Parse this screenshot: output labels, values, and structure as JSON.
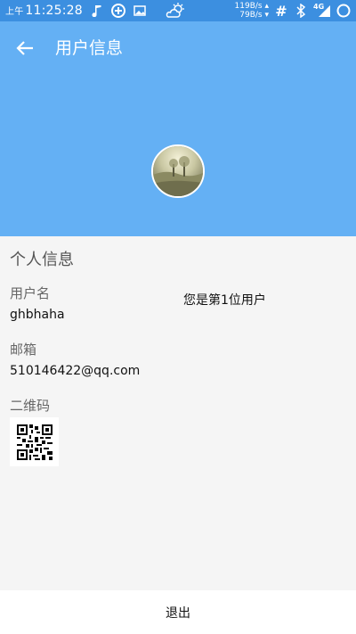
{
  "status_bar": {
    "ampm": "上午",
    "time": "11:25:28",
    "speed_up": "119B/s",
    "speed_down": "79B/s",
    "network": "4G"
  },
  "header": {
    "title": "用户信息",
    "colors": {
      "status_bar": "#3c8fe0",
      "header": "#64b0f4"
    }
  },
  "profile": {
    "section_title": "个人信息",
    "username_label": "用户名",
    "username": "ghbhaha",
    "email_label": "邮箱",
    "email": "510146422@qq.com",
    "qrcode_label": "二维码",
    "rank_text": "您是第1位用户"
  },
  "footer": {
    "logout_label": "退出"
  }
}
